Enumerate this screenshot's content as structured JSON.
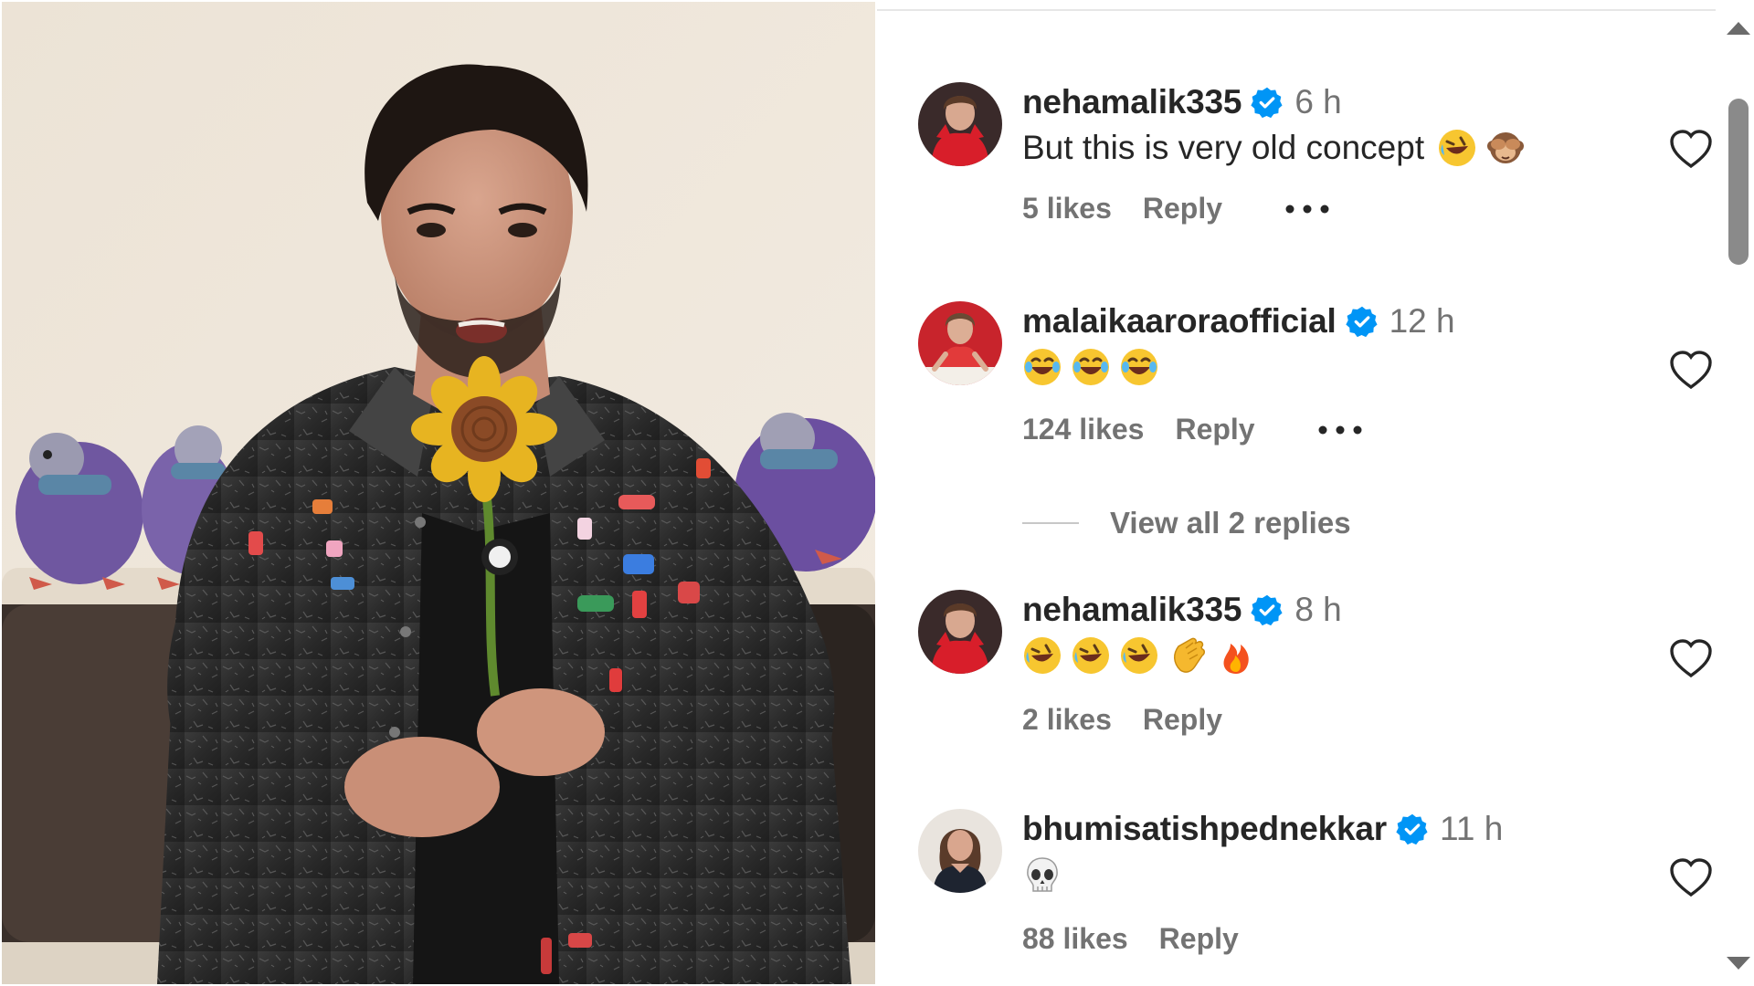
{
  "photo": {
    "subject": "man in dark acid-wash denim jacket with patches holding a crochet sunflower, plush pigeons on a sofa behind"
  },
  "comments": [
    {
      "username": "nehamalik335",
      "time": "6 h",
      "text": "But this is very old concept",
      "emojis": [
        "rolling-on-floor-laughing",
        "see-no-evil-monkey"
      ],
      "likes": "5 likes",
      "reply": "Reply",
      "more": true
    },
    {
      "username": "malaikaaroraofficial",
      "time": "12 h",
      "text": "",
      "emojis": [
        "tears-of-joy",
        "tears-of-joy",
        "tears-of-joy"
      ],
      "likes": "124 likes",
      "reply": "Reply",
      "more": true,
      "view_replies": "View all 2 replies"
    },
    {
      "username": "nehamalik335",
      "time": "8 h",
      "text": "",
      "emojis": [
        "rolling-on-floor-laughing",
        "rolling-on-floor-laughing",
        "rolling-on-floor-laughing",
        "clapping-hands",
        "fire"
      ],
      "likes": "2 likes",
      "reply": "Reply",
      "more": false
    },
    {
      "username": "bhumisatishpednekkar",
      "time": "11 h",
      "text": "",
      "emojis": [
        "skull"
      ],
      "likes": "88 likes",
      "reply": "Reply",
      "more": false
    }
  ],
  "icons": {
    "verified": "verified-badge-icon",
    "heart": "heart-outline-icon",
    "more": "more-options-icon"
  },
  "colors": {
    "verified_blue": "#0095f6",
    "secondary_text": "#737373",
    "primary_text": "#262626"
  }
}
